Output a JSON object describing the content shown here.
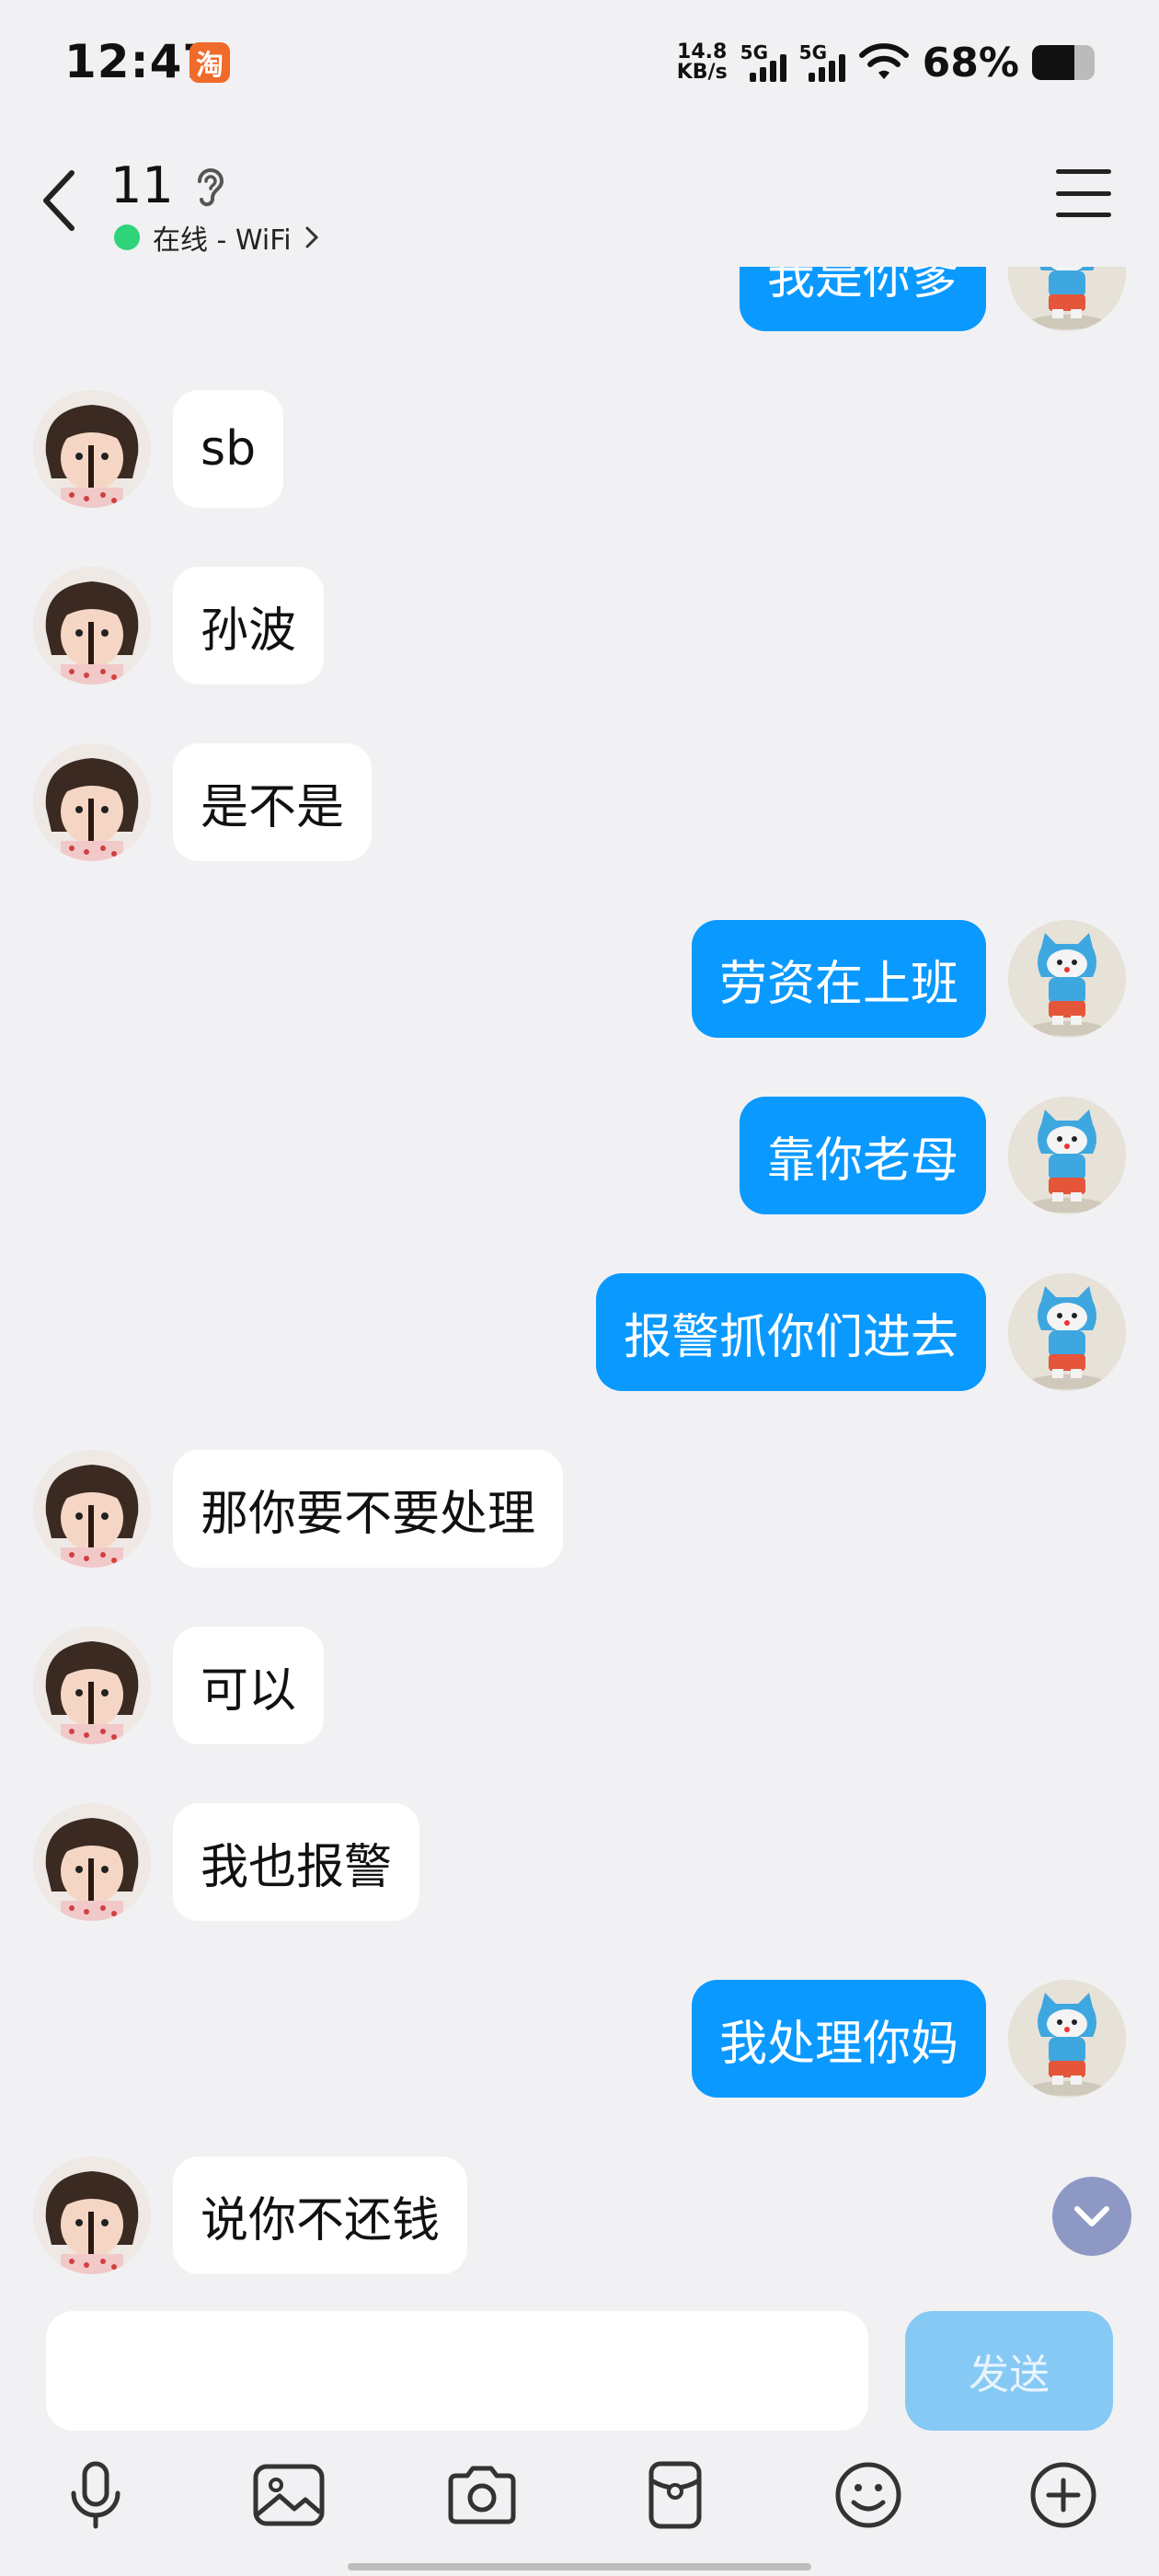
{
  "status_bar": {
    "time": "12:47",
    "app_icon_glyph": "淘",
    "speed_value": "14.8",
    "speed_unit": "KB/s",
    "signal1_label": "5G",
    "signal2_label": "5G",
    "battery": "68%",
    "battery_level": 0.68
  },
  "header": {
    "title": "11",
    "status": "在线 - WiFi"
  },
  "messages": [
    {
      "side": "right",
      "text": "我是你爹"
    },
    {
      "side": "left",
      "text": "sb"
    },
    {
      "side": "left",
      "text": "孙波"
    },
    {
      "side": "left",
      "text": "是不是"
    },
    {
      "side": "right",
      "text": "劳资在上班"
    },
    {
      "side": "right",
      "text": "靠你老母"
    },
    {
      "side": "right",
      "text": "报警抓你们进去"
    },
    {
      "side": "left",
      "text": "那你要不要处理"
    },
    {
      "side": "left",
      "text": "可以"
    },
    {
      "side": "left",
      "text": "我也报警"
    },
    {
      "side": "right",
      "text": "我处理你妈"
    },
    {
      "side": "left",
      "text": "说你不还钱"
    }
  ],
  "input": {
    "placeholder": "",
    "send_label": "发送"
  },
  "toolbar": {
    "icons": [
      "microphone-icon",
      "image-icon",
      "camera-icon",
      "red-packet-icon",
      "emoji-icon",
      "plus-icon"
    ]
  },
  "colors": {
    "accent": "#0a99ff",
    "background": "#f1f1f3",
    "online": "#2ed37a",
    "send_disabled": "#86c9f5"
  }
}
